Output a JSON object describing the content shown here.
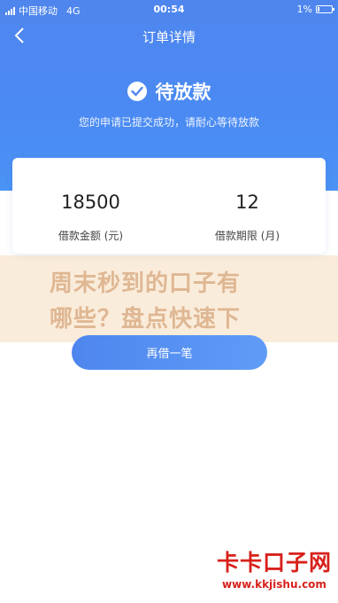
{
  "status_bar": {
    "carrier": "中国移动",
    "network": "4G",
    "time": "00:54",
    "battery": "1%"
  },
  "nav": {
    "title": "订单详情",
    "back_icon": "chevron-left-icon"
  },
  "status": {
    "icon": "check-circle-icon",
    "title": "待放款",
    "description": "您的申请已提交成功，请耐心等待放款"
  },
  "loan": {
    "amount_value": "18500",
    "amount_label": "借款金额 (元)",
    "term_value": "12",
    "term_label": "借款期限 (月)"
  },
  "overlay": {
    "line1": "周末秒到的口子有",
    "line2": "哪些？盘点快速下"
  },
  "action": {
    "borrow_again_label": "再借一笔"
  },
  "watermark": {
    "name": "卡卡口子网",
    "url": "www.kkjishu.com"
  },
  "colors": {
    "primary": "#4f86ee",
    "watermark_red": "#d8211b"
  }
}
